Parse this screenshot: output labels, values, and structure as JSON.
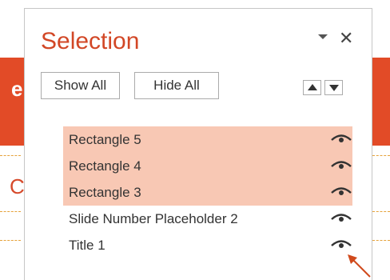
{
  "pane": {
    "title": "Selection",
    "show_all_label": "Show All",
    "hide_all_label": "Hide All"
  },
  "background_slide": {
    "letter_edge": "e",
    "letter_o": "C"
  },
  "items": [
    {
      "label": "Rectangle 5",
      "selected": true,
      "visible": true
    },
    {
      "label": "Rectangle 4",
      "selected": true,
      "visible": true
    },
    {
      "label": "Rectangle 3",
      "selected": true,
      "visible": true
    },
    {
      "label": "Slide Number Placeholder 2",
      "selected": false,
      "visible": true
    },
    {
      "label": "Title 1",
      "selected": false,
      "visible": true
    }
  ],
  "colors": {
    "title": "#d24726",
    "selected_row": "#f8c8b4",
    "annotation_arrow": "#d04a1c"
  },
  "icons": {
    "menu": "chevron-down-icon",
    "close": "close-icon",
    "visibility": "eye-icon",
    "bring_forward": "triangle-up-icon",
    "send_backward": "triangle-down-icon"
  }
}
